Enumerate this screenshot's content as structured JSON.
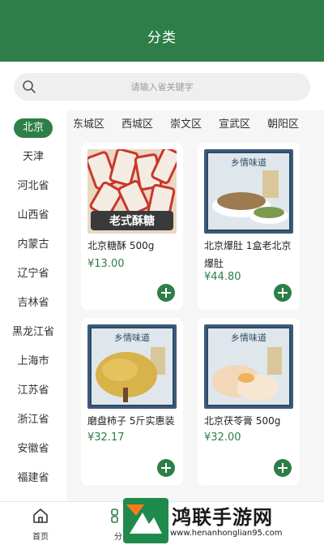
{
  "header": {
    "title": "分类"
  },
  "search": {
    "placeholder": "请输入省关键字"
  },
  "sidebar": {
    "items": [
      "北京",
      "天津",
      "河北省",
      "山西省",
      "内蒙古",
      "辽宁省",
      "吉林省",
      "黑龙江省",
      "上海市",
      "江苏省",
      "浙江省",
      "安徽省",
      "福建省"
    ],
    "active_index": 0
  },
  "tabs": [
    "东城区",
    "西城区",
    "崇文区",
    "宣武区",
    "朝阳区"
  ],
  "products": [
    {
      "name": "北京糖酥 500g",
      "price": "¥13.00",
      "image_text": "老式酥糖"
    },
    {
      "name": "北京爆肚 1盒老北京爆肚",
      "price": "¥44.80",
      "image_text": "乡情味道"
    },
    {
      "name": "磨盘柿子 5斤实惠装",
      "price": "¥32.17",
      "image_text": "乡情味道"
    },
    {
      "name": "北京茯苓膏 500g",
      "price": "¥32.00",
      "image_text": "乡情味道"
    }
  ],
  "tabbar": [
    {
      "label": "首页",
      "icon": "home-icon"
    },
    {
      "label": "分",
      "icon": "category-icon"
    }
  ],
  "watermark": {
    "text": "鸿联手游网",
    "url": "www.henanhonglian95.com"
  },
  "colors": {
    "brand": "#2d7e47",
    "background": "#f5f6f5"
  }
}
